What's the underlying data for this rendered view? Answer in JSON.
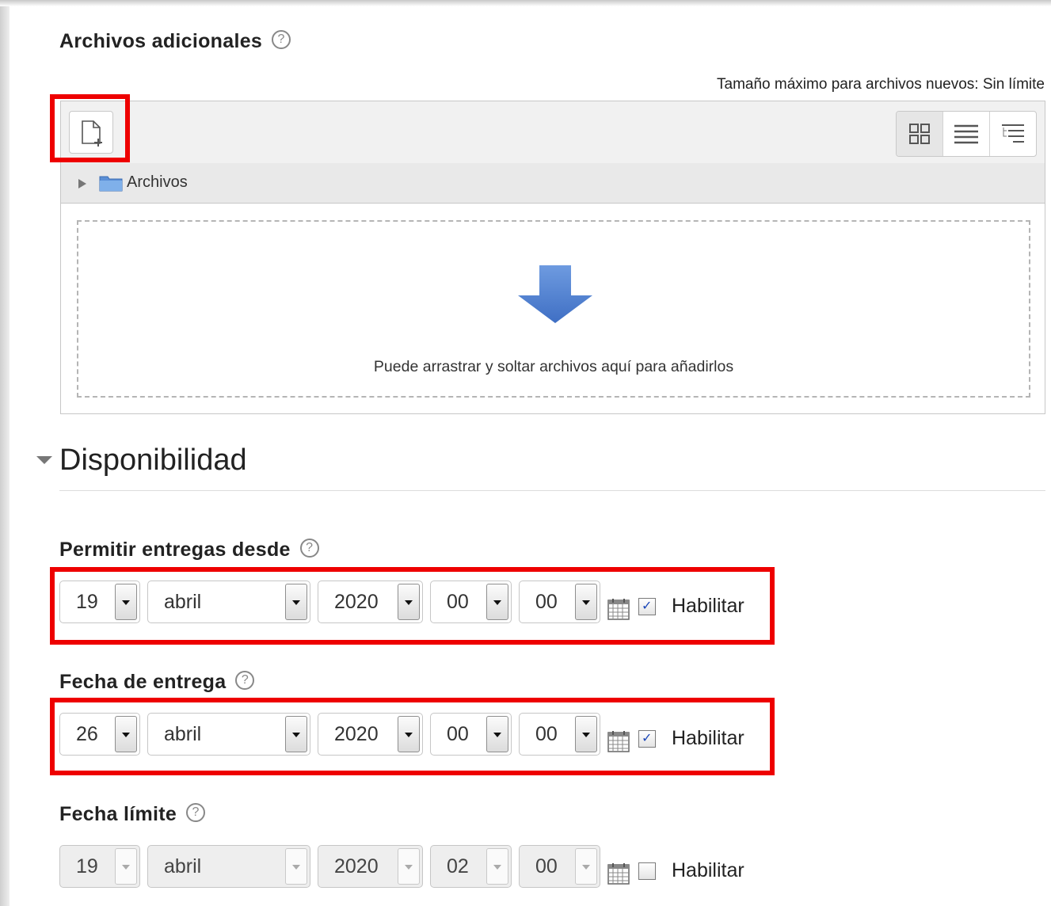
{
  "files": {
    "heading": "Archivos adicionales",
    "help": "?",
    "max_size": "Tamaño máximo para archivos nuevos: Sin límite",
    "path_folder": "Archivos",
    "drop_text": "Puede arrastrar y soltar archivos aquí para añadirlos"
  },
  "section": {
    "title": "Disponibilidad"
  },
  "fields": [
    {
      "label": "Permitir entregas desde",
      "day": "19",
      "month": "abril",
      "year": "2020",
      "hour": "00",
      "minute": "00",
      "enable_label": "Habilitar",
      "enabled": true
    },
    {
      "label": "Fecha de entrega",
      "day": "26",
      "month": "abril",
      "year": "2020",
      "hour": "00",
      "minute": "00",
      "enable_label": "Habilitar",
      "enabled": true
    },
    {
      "label": "Fecha límite",
      "day": "19",
      "month": "abril",
      "year": "2020",
      "hour": "02",
      "minute": "00",
      "enable_label": "Habilitar",
      "enabled": false
    }
  ],
  "colors": {
    "highlight": "#ee0000",
    "accent_arrow": "#4a7fd0",
    "folder": "#5b8fd6"
  }
}
